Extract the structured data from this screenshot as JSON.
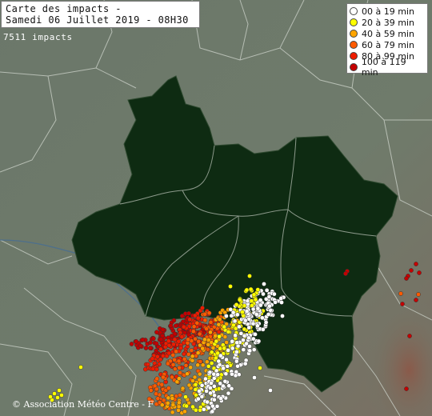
{
  "header": {
    "title_line1": "Carte des impacts -",
    "title_line2": "Samedi 06 Juillet 2019 - 08H30",
    "impact_count": "7511 impacts"
  },
  "legend": {
    "items": [
      {
        "label": "00 à 19 min",
        "color": "#ffffff"
      },
      {
        "label": "20 à 39 min",
        "color": "#ffff00"
      },
      {
        "label": "40 à 59 min",
        "color": "#ffa500"
      },
      {
        "label": "60 à 79 min",
        "color": "#ff5a00"
      },
      {
        "label": "80 à 99 min",
        "color": "#ee1c00"
      },
      {
        "label": "100 à 119 min",
        "color": "#c40000"
      }
    ]
  },
  "footer": {
    "copyright": "© Association Météo Centre - F"
  },
  "colors": {
    "region": "#0e2b12",
    "surrounding": "#6d7a6a",
    "borders": "#c9cfc6",
    "rivers": "#4d6f8c"
  }
}
